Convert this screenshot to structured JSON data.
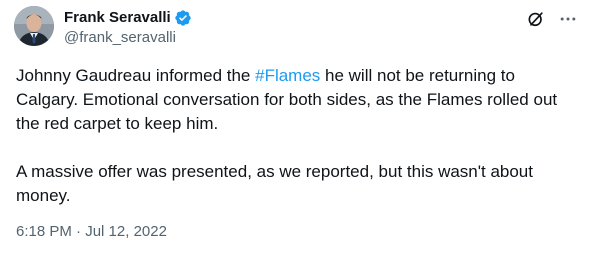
{
  "author": {
    "display_name": "Frank Seravalli",
    "handle": "@frank_seravalli",
    "verified": true,
    "avatar": "profile-photo"
  },
  "tweet": {
    "text_part1": "Johnny Gaudreau informed the ",
    "hashtag": "#Flames",
    "text_part2": " he will not be returning to Calgary. Emotional conversation for both sides, as the Flames rolled out the red carpet to keep him.\n\nA massive offer was presented, as we reported, but this wasn't about money.",
    "time": "6:18 PM",
    "separator": "·",
    "date": "Jul 12, 2022"
  },
  "icons": {
    "verified": "verified-badge-icon",
    "grok": "grok-icon",
    "more": "more-icon"
  },
  "colors": {
    "accent": "#1d9bf0",
    "text": "#0f1419",
    "secondary": "#536471"
  }
}
